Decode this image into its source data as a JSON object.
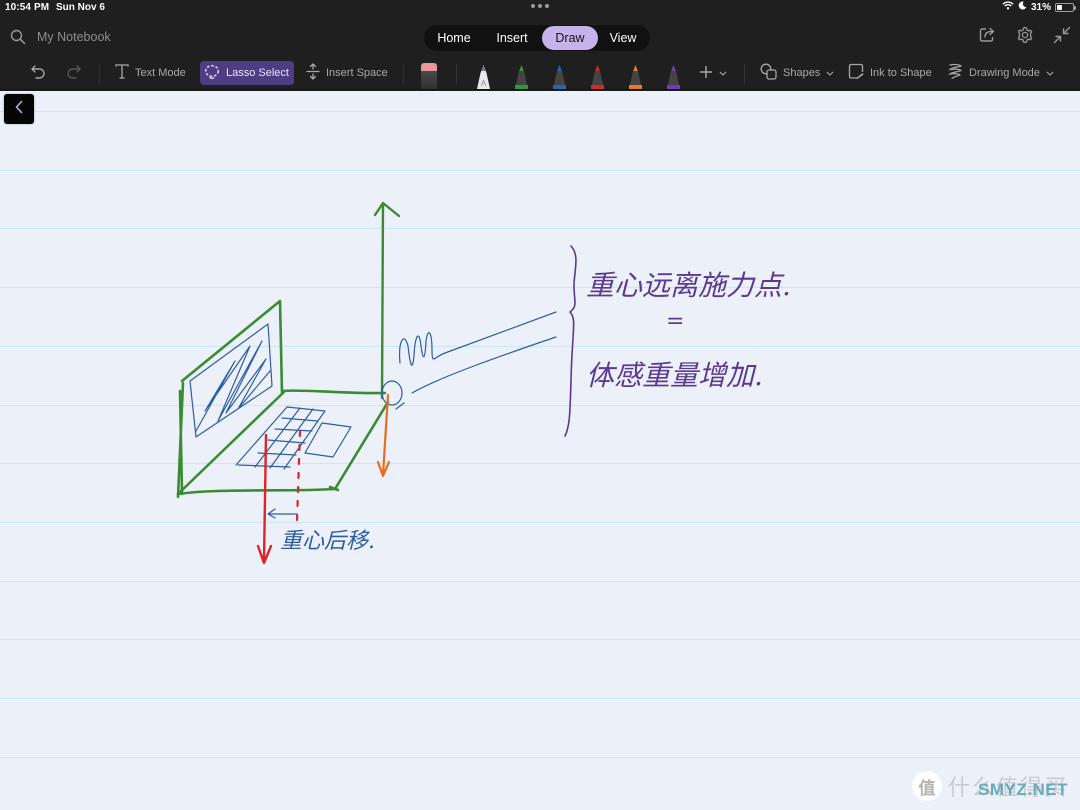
{
  "status_bar": {
    "time": "10:54 PM",
    "date": "Sun Nov 6",
    "battery_percent_label": "31%",
    "battery_level": 0.31,
    "icons": [
      "wifi-icon",
      "moon-icon",
      "battery-icon"
    ]
  },
  "header": {
    "notebook_name": "My Notebook",
    "search_icon": "search-icon",
    "tabs": [
      {
        "label": "Home",
        "active": false
      },
      {
        "label": "Insert",
        "active": false
      },
      {
        "label": "Draw",
        "active": true
      },
      {
        "label": "View",
        "active": false
      }
    ],
    "actions": [
      "share-icon",
      "gear-icon",
      "collapse-icon"
    ]
  },
  "toolbar": {
    "undo_icon": "undo-icon",
    "redo_icon": "redo-icon",
    "text_mode_label": "Text Mode",
    "lasso_select_label": "Lasso Select",
    "insert_space_label": "Insert Space",
    "eraser_icon": "eraser-icon",
    "pens": [
      {
        "name": "white-highlighter-pen",
        "color": "#e8e8e8",
        "letter": "A"
      },
      {
        "name": "green-pen",
        "color": "#2e9a3a"
      },
      {
        "name": "blue-pen",
        "color": "#2b63b3"
      },
      {
        "name": "red-pen",
        "color": "#d9262b"
      },
      {
        "name": "orange-pen",
        "color": "#ea7a1f"
      },
      {
        "name": "purple-pen",
        "color": "#6c3cc3"
      }
    ],
    "add_pen_icon": "plus-icon",
    "shapes_label": "Shapes",
    "ink_to_shape_label": "Ink to Shape",
    "drawing_mode_label": "Drawing Mode"
  },
  "page": {
    "back_icon": "chevron-left-icon",
    "ink_colors": {
      "green": "#3a8b34",
      "blue": "#2d5ea2",
      "red": "#d9262b",
      "orange": "#e86d23",
      "purple": "#5b3a91"
    },
    "annotations": {
      "center_of_gravity_back": "重心后移.",
      "right_line_1": "重心远离施力点.",
      "equals": "=",
      "right_line_2": "体感重量增加."
    }
  },
  "watermark": {
    "badge": "值",
    "text": "什么值得买",
    "overlay": "SMYZ.NET"
  }
}
